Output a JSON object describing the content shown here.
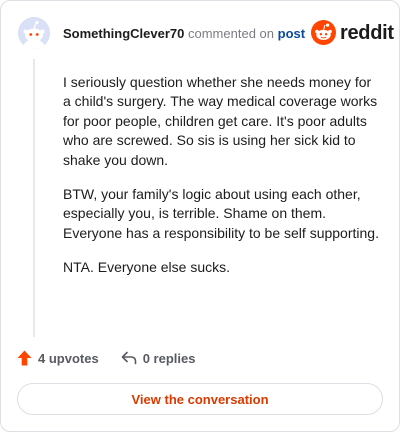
{
  "header": {
    "username": "SomethingClever70",
    "commented_text": "commented on",
    "post_link": "post"
  },
  "brand": {
    "logo_text": "reddit",
    "accent_color": "#ff4500"
  },
  "comment": {
    "paragraphs": [
      "I seriously question whether she needs money for a child's surgery. The way medical coverage works for poor people, children get care. It's poor adults who are screwed. So sis is using her sick kid to shake you down.",
      "BTW, your family's logic about using each other, especially you, is terrible. Shame on them. Everyone has a responsibility to be self supporting.",
      "NTA. Everyone else sucks."
    ]
  },
  "actions": {
    "upvotes_label": "4 upvotes",
    "replies_label": "0 replies",
    "upvote_icon": "arrow-up-icon",
    "reply_icon": "reply-icon"
  },
  "footer": {
    "view_button_label": "View the conversation"
  }
}
